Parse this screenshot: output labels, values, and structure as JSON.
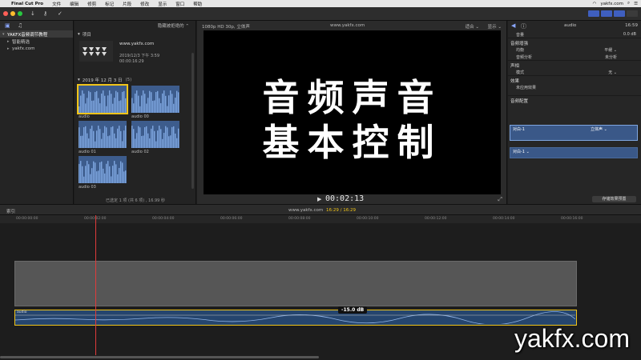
{
  "menubar": {
    "app": "Final Cut Pro",
    "items": [
      "文件",
      "编辑",
      "修剪",
      "标记",
      "片段",
      "修改",
      "显示",
      "窗口",
      "帮助"
    ],
    "right_text": "yakfx.com"
  },
  "libraries": {
    "items": [
      {
        "label": "YAKFX音频调节教程",
        "selected": true
      },
      {
        "label": "智能精选",
        "selected": false
      },
      {
        "label": "yakfx.com",
        "selected": false
      }
    ]
  },
  "browser": {
    "filter_label": "隐藏被拒绝的 ⌃",
    "projects_section": "项目",
    "project": {
      "site": "www.yakfx.com",
      "date": "2019/12/3 下午 3:59",
      "duration": "00:00:16:29"
    },
    "date_section": "2019 年 12 月 3 日",
    "date_count": "(5)",
    "clips": [
      "audio",
      "audio 00",
      "audio 01",
      "audio 02",
      "audio 03"
    ],
    "footer": "已选定 1 项 (共 6 项) , 16.99 秒"
  },
  "viewer": {
    "format": "1080p HD 30p, 立体声",
    "title": "www.yakfx.com",
    "fit": "适合 ⌄",
    "display": "显示 ⌄",
    "overlay_line1": "音频声音",
    "overlay_line2": "基本控制",
    "timecode": "00:02:13"
  },
  "inspector": {
    "name": "audio",
    "duration": "16:59",
    "volume_label": "音量",
    "volume_value": "0.0 dB",
    "enhance_section": "音频增强",
    "eq_label": "均衡",
    "eq_value": "平缓 ⌄",
    "analysis_label": "音频分析",
    "analysis_value": "未分析",
    "pan_section": "声相",
    "mode_label": "模式",
    "mode_value": "无 ⌄",
    "effects_section": "效果",
    "effects_empty": "未应用效果",
    "config_section": "音频配置",
    "channel1": "对白-1",
    "channel1_mode": "立体声 ⌄",
    "channel2": "对白-1 ⌄",
    "save_button": "存储效果预置"
  },
  "timeline": {
    "index_label": "索引",
    "project": "www.yakfx.com",
    "time": "16:29 / 16:29",
    "ruler": [
      "00:00:00:00",
      "00:00:02:00",
      "00:00:04:00",
      "00:00:06:00",
      "00:00:08:00",
      "00:00:10:00",
      "00:00:12:00",
      "00:00:14:00",
      "00:00:16:00"
    ],
    "audio_clip": "audio",
    "db_badge": "-15.0 dB"
  },
  "watermark": "yakfx.com"
}
